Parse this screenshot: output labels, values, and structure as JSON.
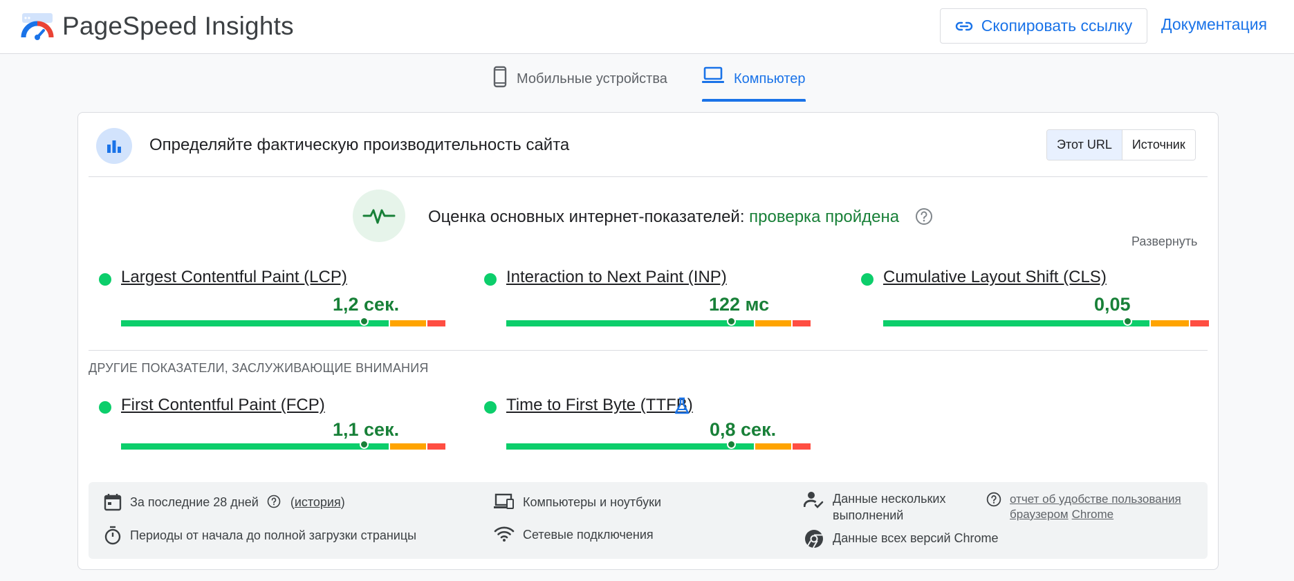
{
  "header": {
    "brand": "PageSpeed Insights",
    "copy_link": "Скопировать ссылку",
    "docs": "Документация"
  },
  "tabs": {
    "mobile": "Мобильные устройства",
    "desktop": "Компьютер",
    "active": "desktop"
  },
  "card": {
    "title": "Определяйте фактическую производительность сайта",
    "segment": {
      "this_url": "Этот URL",
      "origin": "Источник",
      "active": "this_url"
    }
  },
  "assessment": {
    "label": "Оценка основных интернет-показателей: ",
    "status": "проверка пройдена",
    "expand": "Развернуть"
  },
  "core_metrics": [
    {
      "name": "Largest Contentful Paint (LCP)",
      "value": "1,2 сек.",
      "marker_fraction": 0.75
    },
    {
      "name": "Interaction to Next Paint (INP)",
      "value": "122 мс",
      "marker_fraction": 0.74
    },
    {
      "name": "Cumulative Layout Shift (CLS)",
      "value": "0,05",
      "marker_fraction": 0.75
    }
  ],
  "other_heading": "ДРУГИЕ ПОКАЗАТЕЛИ, ЗАСЛУЖИВАЮЩИЕ ВНИМАНИЯ",
  "other_metrics": [
    {
      "name": "First Contentful Paint (FCP)",
      "value": "1,1 сек.",
      "marker_fraction": 0.75
    },
    {
      "name": "Time to First Byte (TTFB)",
      "value": "0,8 сек.",
      "marker_fraction": 0.74
    }
  ],
  "info": {
    "period": "За последние 28 дней",
    "history_open": "(",
    "history": "история",
    "history_close": ")",
    "sessions": "Периоды от начала до полной загрузки страницы",
    "devices": "Компьютеры и ноутбуки",
    "network": "Сетевые подключения",
    "samples": "Данные нескольких выполнений",
    "chrome_versions": "Данные всех версий Chrome",
    "crux_link_part1": "отчет об удобстве пользования",
    "crux_link_part2a": "браузером",
    "crux_link_part2b": "Chrome"
  },
  "colors": {
    "accent": "#1a73e8",
    "good": "#0cce6b",
    "good_text": "#188038",
    "average": "#ffa400",
    "poor": "#ff4e42"
  }
}
